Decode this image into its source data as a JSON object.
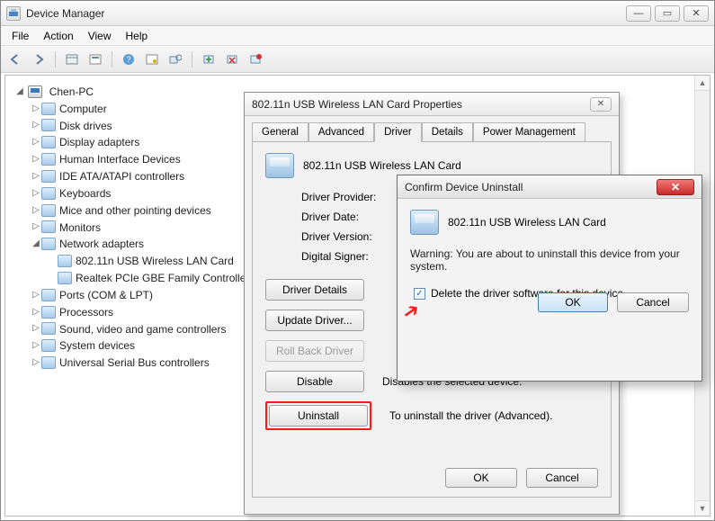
{
  "app": {
    "title": "Device Manager"
  },
  "menubar": {
    "file": "File",
    "action": "Action",
    "view": "View",
    "help": "Help"
  },
  "toolbar_icons": {
    "back": "back-icon",
    "forward": "forward-icon",
    "show_hidden": "show-hidden-icon",
    "properties": "properties-icon",
    "help": "help-icon",
    "action_props": "action-properties-icon",
    "scan": "scan-hardware-icon",
    "enable": "enable-device-icon",
    "disable": "disable-device-icon",
    "update": "update-driver-icon"
  },
  "tree": {
    "root": "Chen-PC",
    "nodes": [
      "Computer",
      "Disk drives",
      "Display adapters",
      "Human Interface Devices",
      "IDE ATA/ATAPI controllers",
      "Keyboards",
      "Mice and other pointing devices",
      "Monitors"
    ],
    "network": {
      "label": "Network adapters",
      "children": [
        "802.11n USB Wireless LAN Card",
        "Realtek PCIe GBE Family Controlle"
      ]
    },
    "nodes2": [
      "Ports (COM & LPT)",
      "Processors",
      "Sound, video and game controllers",
      "System devices",
      "Universal Serial Bus controllers"
    ]
  },
  "props": {
    "title": "802.11n USB Wireless LAN Card Properties",
    "tabs": {
      "general": "General",
      "advanced": "Advanced",
      "driver": "Driver",
      "details": "Details",
      "power": "Power Management"
    },
    "device_name": "802.11n USB Wireless LAN Card",
    "labels": {
      "provider": "Driver Provider:",
      "date": "Driver Date:",
      "version": "Driver Version:",
      "signer": "Digital Signer:"
    },
    "buttons": {
      "details": "Driver Details",
      "update": "Update Driver...",
      "rollback": "Roll Back Driver",
      "disable": "Disable",
      "uninstall": "Uninstall"
    },
    "desc": {
      "disable": "Disables the selected device.",
      "uninstall": "To uninstall the driver (Advanced)."
    },
    "ok": "OK",
    "cancel": "Cancel"
  },
  "confirm": {
    "title": "Confirm Device Uninstall",
    "device": "802.11n USB Wireless LAN Card",
    "warning": "Warning: You are about to uninstall this device from your system.",
    "checkbox": "Delete the driver software for this device.",
    "checked": true,
    "ok": "OK",
    "cancel": "Cancel"
  }
}
